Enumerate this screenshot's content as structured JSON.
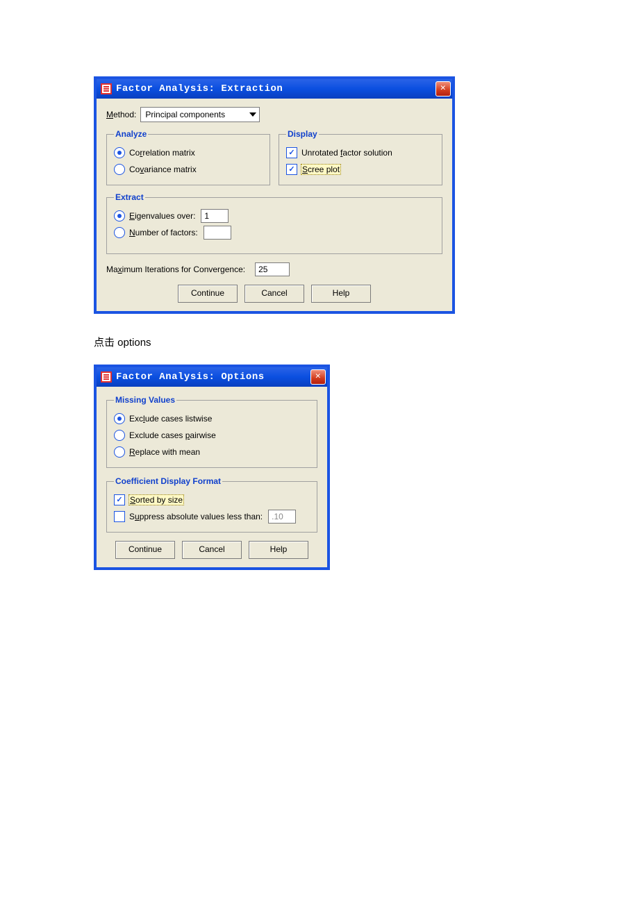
{
  "dialog1": {
    "title": "Factor Analysis: Extraction",
    "method_label_pre": "M",
    "method_label_post": "ethod:",
    "method_value": "Principal components",
    "analyze": {
      "legend": "Analyze",
      "correlation_pre": "Co",
      "correlation_u": "r",
      "correlation_post": "relation matrix",
      "covariance_pre": "Co",
      "covariance_u": "v",
      "covariance_post": "ariance matrix"
    },
    "display": {
      "legend": "Display",
      "unrotated_pre": "Unrotated ",
      "unrotated_u": "f",
      "unrotated_post": "actor solution",
      "scree_u": "S",
      "scree_post": "cree plot"
    },
    "extract": {
      "legend": "Extract",
      "eigen_u": "E",
      "eigen_post": "igenvalues over:",
      "eigen_value": "1",
      "nfact_u": "N",
      "nfact_post": "umber of factors:"
    },
    "maxiter_pre": "Ma",
    "maxiter_u": "x",
    "maxiter_post": "imum Iterations for Convergence:",
    "maxiter_value": "25",
    "buttons": {
      "continue": "Continue",
      "cancel": "Cancel",
      "help": "Help"
    }
  },
  "caption": "点击 options",
  "dialog2": {
    "title": "Factor Analysis: Options",
    "missing": {
      "legend": "Missing Values",
      "listwise_pre": "Exc",
      "listwise_u": "l",
      "listwise_post": "ude cases listwise",
      "pairwise_pre": "Exclude cases ",
      "pairwise_u": "p",
      "pairwise_post": "airwise",
      "mean_u": "R",
      "mean_post": "eplace with mean"
    },
    "coef": {
      "legend": "Coefficient Display Format",
      "sorted_u": "S",
      "sorted_post": "orted by size",
      "suppress_pre": "S",
      "suppress_u": "u",
      "suppress_post": "ppress absolute values less than:",
      "suppress_value": ".10"
    },
    "buttons": {
      "continue": "Continue",
      "cancel": "Cancel",
      "help": "Help"
    }
  }
}
